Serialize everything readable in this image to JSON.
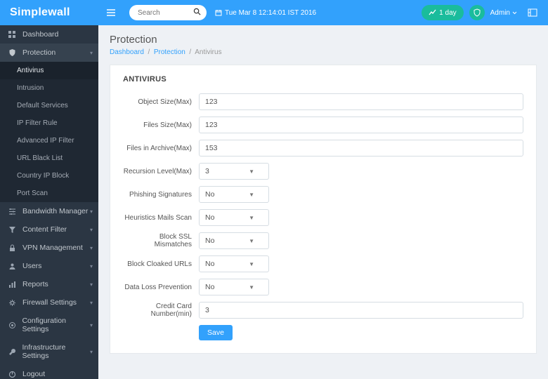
{
  "brand": "Simplewall",
  "search": {
    "placeholder": "Search"
  },
  "datetime": "Tue Mar 8 12:14:01 IST 2016",
  "timerange": {
    "label": "1 day"
  },
  "admin": {
    "label": "Admin"
  },
  "sidebar": {
    "items": [
      {
        "label": "Dashboard"
      },
      {
        "label": "Protection"
      },
      {
        "label": "Bandwidth Manager"
      },
      {
        "label": "Content Filter"
      },
      {
        "label": "VPN Management"
      },
      {
        "label": "Users"
      },
      {
        "label": "Reports"
      },
      {
        "label": "Firewall Settings"
      },
      {
        "label": "Configuration Settings"
      },
      {
        "label": "Infrastructure Settings"
      },
      {
        "label": "Logout"
      }
    ],
    "protection_subs": [
      {
        "label": "Antivirus"
      },
      {
        "label": "Intrusion"
      },
      {
        "label": "Default Services"
      },
      {
        "label": "IP Filter Rule"
      },
      {
        "label": "Advanced IP Filter"
      },
      {
        "label": "URL Black List"
      },
      {
        "label": "Country IP Block"
      },
      {
        "label": "Port Scan"
      }
    ]
  },
  "page": {
    "title": "Protection",
    "breadcrumb": {
      "a": "Dashboard",
      "b": "Protection",
      "c": "Antivirus",
      "sep": "/"
    }
  },
  "panel": {
    "title": "ANTIVIRUS",
    "fields": {
      "object_size": {
        "label": "Object Size(Max)",
        "value": "123"
      },
      "files_size": {
        "label": "Files Size(Max)",
        "value": "123"
      },
      "files_archive": {
        "label": "Files in Archive(Max)",
        "value": "153"
      },
      "recursion": {
        "label": "Recursion Level(Max)",
        "value": "3"
      },
      "phishing": {
        "label": "Phishing Signatures",
        "value": "No"
      },
      "heuristics": {
        "label": "Heuristics Mails Scan",
        "value": "No"
      },
      "ssl": {
        "label": "Block SSL Mismatches",
        "value": "No"
      },
      "cloaked": {
        "label": "Block Cloaked URLs",
        "value": "No"
      },
      "dlp": {
        "label": "Data Loss Prevention",
        "value": "No"
      },
      "cc": {
        "label": "Credit Card Number(min)",
        "value": "3"
      }
    },
    "save": "Save"
  }
}
